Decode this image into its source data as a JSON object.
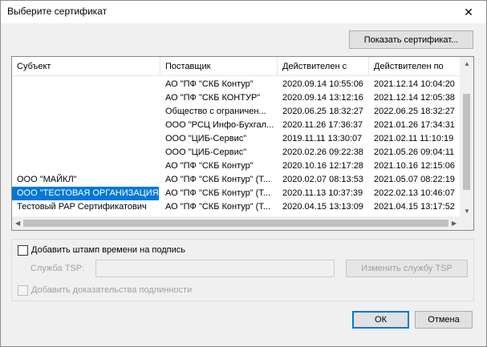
{
  "window": {
    "title": "Выберите сертификат"
  },
  "buttons": {
    "show_certificate": "Показать сертификат...",
    "change_tsp": "Изменить службу TSP",
    "ok": "ОК",
    "cancel": "Отмена"
  },
  "table": {
    "columns": [
      "Субъект",
      "Поставщик",
      "Действителен с",
      "Действителен по"
    ],
    "rows": [
      [
        "",
        "АО \"ПФ \"СКБ Контур\"",
        "2020.09.14 10:55:06",
        "2021.12.14 10:04:20"
      ],
      [
        "",
        "АО \"ПФ \"СКБ КОНТУР\"",
        "2020.09.14 13:12:16",
        "2021.12.14 12:05:38"
      ],
      [
        "",
        "Общество с ограничен...",
        "2020.06.25 18:32:27",
        "2022.06.25 18:32:27"
      ],
      [
        "",
        "ООО \"РСЦ Инфо-Бухгал...",
        "2020.11.26 17:36:37",
        "2021.01.26 17:34:31"
      ],
      [
        "",
        "ООО \"ЦИБ-Сервис\"",
        "2019.11.11 13:30:07",
        "2021.02.11 11:10:19"
      ],
      [
        "",
        "ООО \"ЦИБ-Сервис\"",
        "2020.02.26 09:22:38",
        "2021.05.26 09:04:11"
      ],
      [
        "",
        "АО \"ПФ \"СКБ Контур\"",
        "2020.10.16 12:17:28",
        "2021.10.16 12:15:06"
      ],
      [
        "ООО \"МАЙКЛ\"",
        "АО \"ПФ \"СКБ Контур\" (Т...",
        "2020.02.07 08:13:53",
        "2021.05.07 08:22:19"
      ],
      [
        "ООО \"ТЕСТОВАЯ ОРГАНИЗАЦИЯ...",
        "АО \"ПФ \"СКБ Контур\" (Т...",
        "2020.11.13 10:37:39",
        "2022.02.13 10:46:07"
      ],
      [
        "Тестовый PAP Сертификатович",
        "АО \"ПФ \"СКБ Контур\" (Т...",
        "2020.04.15 13:13:09",
        "2021.04.15 13:17:52"
      ]
    ],
    "selected_row": 8
  },
  "timestamp": {
    "add_stamp_label": "Добавить штамп времени на подпись",
    "tsp_label": "Служба TSP:",
    "tsp_value": "",
    "add_proof_label": "Добавить доказательства подлинности"
  },
  "colors": {
    "selection": "#0078d7",
    "default_border": "#0078d7"
  }
}
